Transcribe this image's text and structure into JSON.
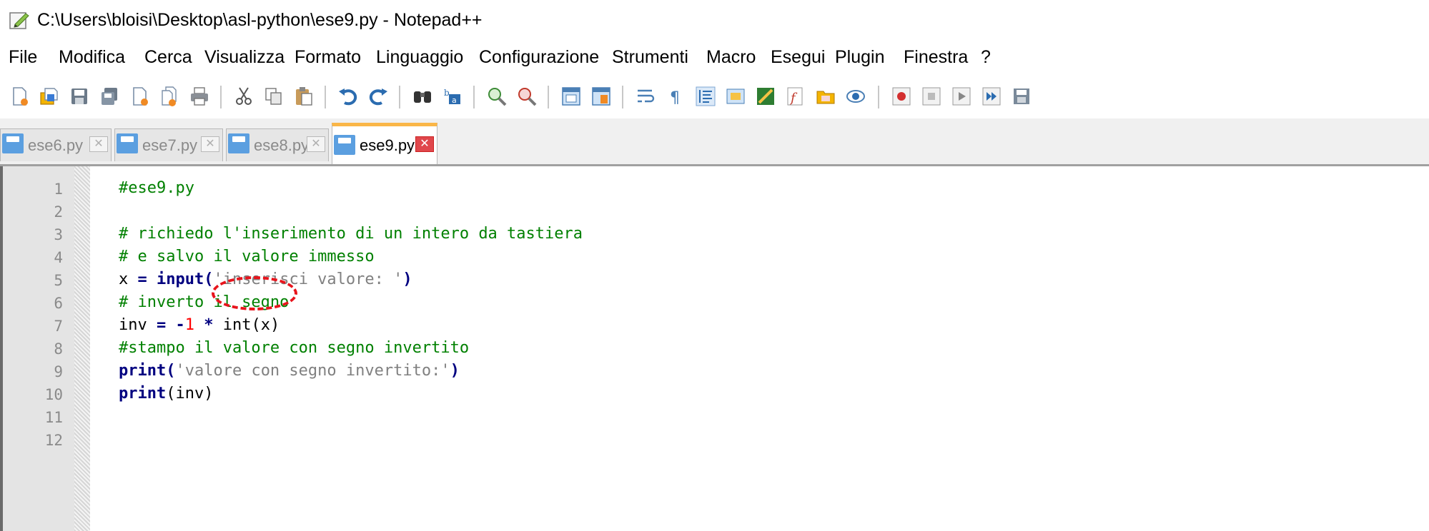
{
  "window": {
    "title": "C:\\Users\\bloisi\\Desktop\\asl-python\\ese9.py - Notepad++"
  },
  "menu": [
    "File",
    "Modifica",
    "Cerca",
    "Visualizza",
    "Formato",
    "Linguaggio",
    "Configurazione",
    "Strumenti",
    "Macro",
    "Esegui",
    "Plugin",
    "Finestra",
    "?"
  ],
  "toolbar": {
    "icons": [
      "new-file-icon",
      "open-file-icon",
      "save-icon",
      "save-all-icon",
      "close-icon",
      "close-all-icon",
      "print-icon",
      "cut-icon",
      "copy-icon",
      "paste-icon",
      "undo-icon",
      "redo-icon",
      "find-icon",
      "replace-icon",
      "zoom-in-icon",
      "zoom-out-icon",
      "sync-vertical-icon",
      "sync-horizontal-icon",
      "word-wrap-icon",
      "show-all-characters-icon",
      "indent-guide-icon",
      "user-language-icon",
      "doc-map-icon",
      "function-list-icon",
      "folder-as-workspace-icon",
      "monitoring-icon",
      "record-macro-icon",
      "stop-recording-icon",
      "play-macro-icon",
      "run-macro-multiple-icon",
      "save-macro-icon"
    ]
  },
  "tabs": [
    {
      "label": "ese6.py",
      "active": false
    },
    {
      "label": "ese7.py",
      "active": false
    },
    {
      "label": "ese8.py",
      "active": false
    },
    {
      "label": "ese9.py",
      "active": true
    }
  ],
  "editor": {
    "line_numbers": [
      "1",
      "2",
      "3",
      "4",
      "5",
      "6",
      "7",
      "8",
      "9",
      "10",
      "11",
      "12"
    ],
    "lines": [
      {
        "comment": "#ese9.py"
      },
      {},
      {
        "comment": "# richiedo l'inserimento di un intero da tastiera"
      },
      {
        "comment": "# e salvo il valore immesso"
      },
      {
        "var": "x",
        "op": " = ",
        "call": "input",
        "open": "(",
        "str": "'inserisci valore: '",
        "close": ")"
      },
      {
        "comment": "# inverto il segno"
      },
      {
        "var": "inv",
        "op": " = -",
        "num": "1",
        "op2": " * ",
        "call": "int",
        "arg": "(x)"
      },
      {
        "comment": "#stampo il valore con segno invertito"
      },
      {
        "call": "print",
        "open": "(",
        "str": "'valore con segno invertito:'",
        "close": ")"
      },
      {
        "call": "print",
        "arg": "(inv)"
      },
      {},
      {}
    ]
  },
  "colors": {
    "comment": "#008000",
    "keyword": "#000080",
    "string": "#808080",
    "number": "#ff0000",
    "active_tab_accent": "#fab648",
    "annotation": "#e8141c"
  }
}
